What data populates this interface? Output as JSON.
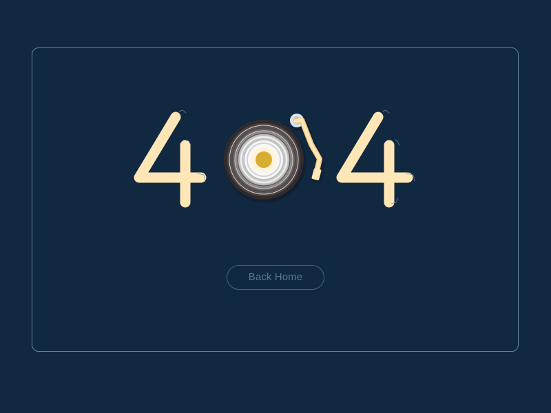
{
  "error": {
    "code_left_digit": "4",
    "code_middle_digit": "0",
    "code_right_digit": "4"
  },
  "actions": {
    "back_home_label": "Back Home"
  },
  "colors": {
    "background": "#112940",
    "panel_border": "#82a8c4",
    "digit_fill": "#ffe6b7",
    "button_border": "#3f6781",
    "button_text": "#537a96",
    "record_dark": "#3a3436",
    "record_light": "#efefef",
    "record_center": "#d8ad31"
  },
  "icons": {
    "record": "turntable-record-icon",
    "tonearm": "tonearm-icon"
  }
}
